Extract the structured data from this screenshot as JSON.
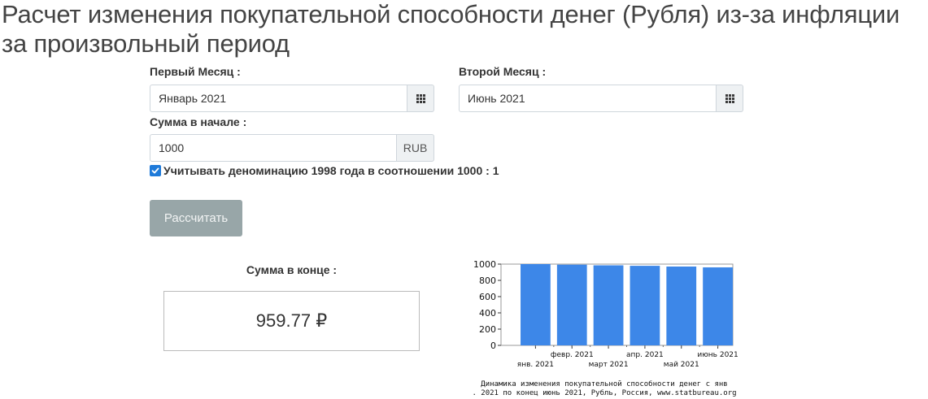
{
  "page": {
    "title": "Расчет изменения покупательной способности денег (Рубля) из-за инфляции за произвольный период"
  },
  "form": {
    "first_month_label": "Первый Месяц :",
    "first_month_value": "Январь 2021",
    "second_month_label": "Второй Месяц :",
    "second_month_value": "Июнь 2021",
    "start_amount_label": "Сумма в начале :",
    "start_amount_value": "1000",
    "currency": "RUB",
    "denomination_checked": true,
    "denomination_label": "Учитывать деноминацию 1998 года в соотношении 1000 : 1",
    "calculate_label": "Рассчитать"
  },
  "result": {
    "label": "Сумма в конце :",
    "value": "959.77 ₽"
  },
  "icons": {
    "calendar": "calendar-grid-icon",
    "checkbox": "check-icon"
  },
  "colors": {
    "bar": "#3d87e8",
    "button": "#98a6a8",
    "checkbox": "#1e7ad9"
  },
  "chart_data": {
    "type": "bar",
    "categories": [
      "янв. 2021",
      "февр. 2021",
      "март 2021",
      "апр. 2021",
      "май 2021",
      "июнь 2021"
    ],
    "category_label_row": [
      2,
      1,
      2,
      1,
      2,
      1
    ],
    "values": [
      1000,
      993,
      985,
      979,
      970,
      959.77
    ],
    "ylim": [
      0,
      1000
    ],
    "yticks": [
      0,
      200,
      400,
      600,
      800,
      1000
    ],
    "grid": false,
    "legend": "none",
    "caption": [
      "Динамика изменения покупательной способности денег с янв",
      ". 2021 по конец июнь 2021, Рубль, Россия, www.statbureau.org"
    ]
  }
}
